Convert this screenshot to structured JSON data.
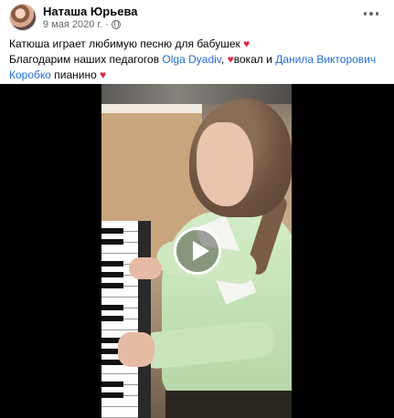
{
  "post": {
    "author": "Наташа Юрьева",
    "date": "9 мая 2020 г.",
    "separator": "·",
    "text": {
      "line1": "Катюша играет любимую песню для бабушек ",
      "line2_pre": "Благодарим наших педагогов ",
      "teacher1": "Olga Dyadiv",
      "line2_mid": ", ",
      "line2_vocal": "вокал и ",
      "teacher2a": "Данила Викторович",
      "teacher2b": "Коробко",
      "line3_post": " пианино "
    },
    "heart_glyph": "♥",
    "link_color": "#216fdb"
  },
  "icons": {
    "avatar": "profile-photo",
    "privacy": "globe-icon",
    "more": "more-options-icon",
    "play": "play-icon"
  }
}
